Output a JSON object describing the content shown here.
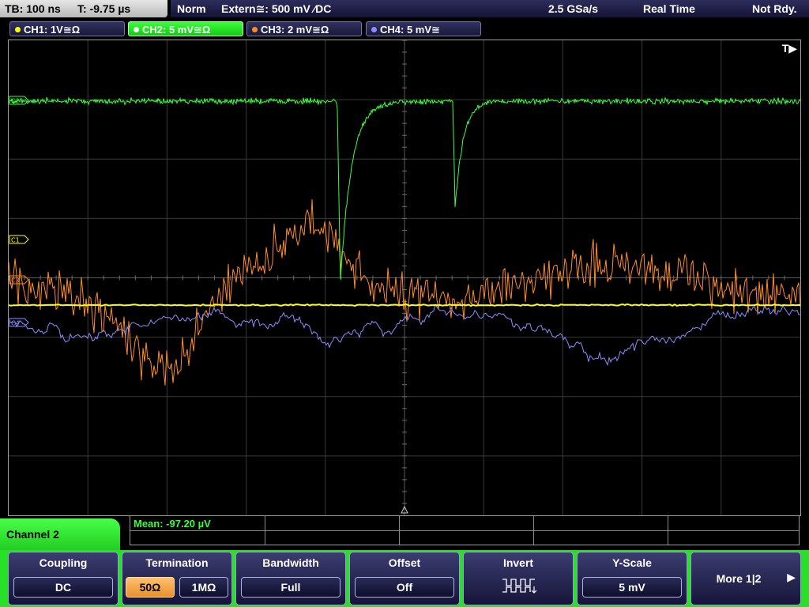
{
  "topbar": {
    "timebase": "TB: 100 ns",
    "trigger_time": "T: -9.75 µs",
    "trigger_mode": "Norm",
    "trigger_source": "Extern≅: 500 mV ⁄DC",
    "sample_rate": "2.5 GSa/s",
    "acq_mode": "Real Time",
    "run_state": "Not Rdy."
  },
  "channels": [
    {
      "label": "CH1: 1V≅Ω",
      "color": "#ffff00",
      "marker": "C1",
      "active": false
    },
    {
      "label": "CH2: 5 mV≅Ω",
      "color": "#39ff39",
      "marker": "C2",
      "active": true
    },
    {
      "label": "CH3: 2 mV≅Ω",
      "color": "#ff8c28",
      "marker": "C3",
      "active": false
    },
    {
      "label": "CH4: 5 mV≅",
      "color": "#8c8cff",
      "marker": "C4",
      "active": false
    }
  ],
  "screen": {
    "trigger_indicator": "T▶",
    "traces": {
      "ch1_level": 0.0,
      "ch2_spikes": [
        {
          "at_div": 4.1
        },
        {
          "at_div": 5.6
        }
      ],
      "description_colors": {
        "ch1": "#ffff00",
        "ch2": "#39ff39",
        "ch3": "#ff8c28",
        "ch4": "#8c8cff"
      }
    }
  },
  "measurement": {
    "mean": "Mean: -97.20 µV"
  },
  "menu": {
    "title": "Channel 2",
    "coupling": {
      "title": "Coupling",
      "value": "DC"
    },
    "termination": {
      "title": "Termination",
      "opt_50": "50Ω",
      "opt_1m": "1MΩ",
      "selected": "50Ω"
    },
    "bandwidth": {
      "title": "Bandwidth",
      "value": "Full"
    },
    "offset": {
      "title": "Offset",
      "value": "Off"
    },
    "invert": {
      "title": "Invert",
      "icon": "invert-waveform-icon"
    },
    "yscale": {
      "title": "Y-Scale",
      "value": "5 mV"
    },
    "more": {
      "label": "More 1|2",
      "arrow": "▶"
    }
  }
}
